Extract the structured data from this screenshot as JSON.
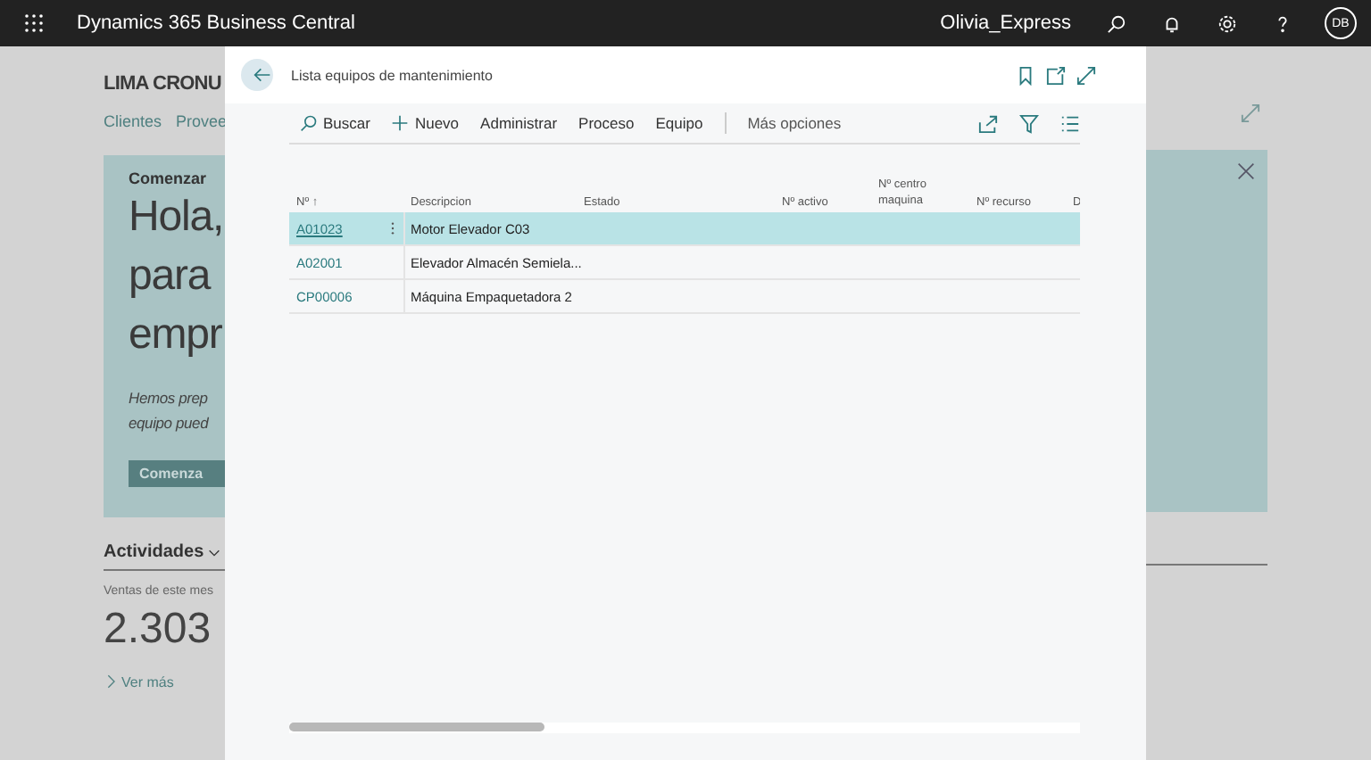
{
  "top_bar": {
    "app_title": "Dynamics 365 Business Central",
    "user": "Olivia_Express",
    "initials": "DB"
  },
  "background_page": {
    "company": "LIMA CRONU",
    "nav": [
      "Clientes",
      "Provee"
    ],
    "card": {
      "label": "Comenzar",
      "heading_lines": [
        "Hola,",
        "para",
        "empr"
      ],
      "body_lines": [
        "Hemos prep",
        "equipo pued"
      ],
      "button": "Comenza"
    },
    "activities": {
      "title": "Actividades",
      "metric_label": "Ventas de este mes",
      "metric_value": "2.303",
      "more_link": "Ver más"
    }
  },
  "dialog": {
    "title": "Lista equipos de mantenimiento",
    "actions": [
      {
        "label": "Buscar",
        "kind": "search"
      },
      {
        "label": "Nuevo",
        "kind": "new"
      },
      {
        "label": "Administrar",
        "kind": "plain"
      },
      {
        "label": "Proceso",
        "kind": "plain"
      },
      {
        "label": "Equipo",
        "kind": "plain"
      }
    ],
    "more_options": "Más opciones",
    "columns": [
      "Nº ↑",
      "Descripcion",
      "Estado",
      "Nº activo",
      "Nº centro maquina",
      "Nº recurso",
      "D"
    ],
    "rows": [
      {
        "no": "A01023",
        "description": "Motor Elevador C03",
        "selected": true
      },
      {
        "no": "A02001",
        "description": "Elevador Almacén Semiela...",
        "selected": false
      },
      {
        "no": "CP00006",
        "description": "Máquina Empaquetadora 2",
        "selected": false
      }
    ]
  }
}
